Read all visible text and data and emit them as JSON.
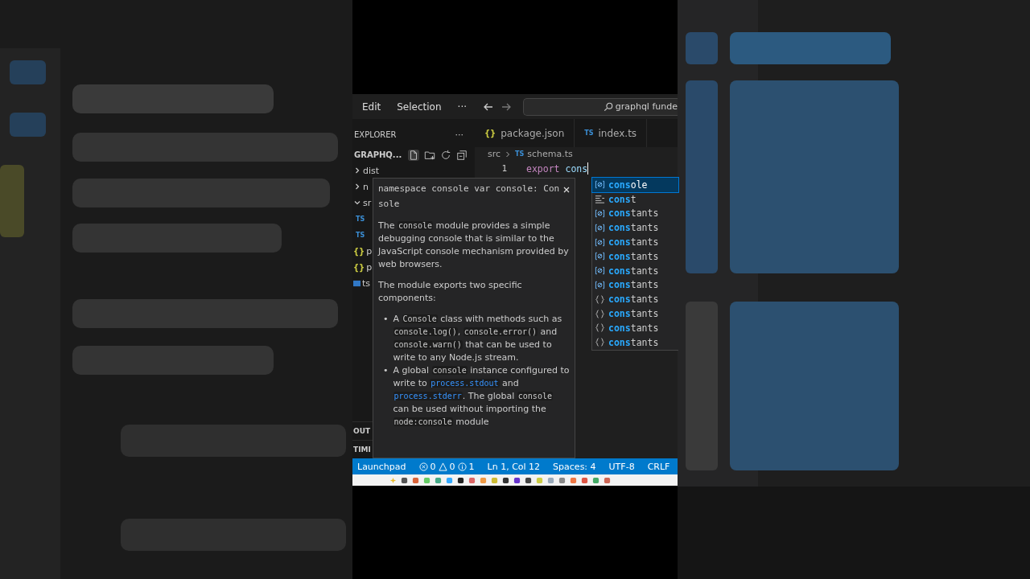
{
  "menu": [
    {
      "label": "Edit"
    },
    {
      "label": "Selection"
    },
    {
      "label": "···"
    }
  ],
  "search": {
    "value": "graphql funde"
  },
  "sidebar": {
    "title": "EXPLORER",
    "more": "···",
    "folder": "GRAPHQ...",
    "tree": [
      {
        "kind": "folder",
        "label": "dist",
        "expanded": false
      },
      {
        "kind": "folder",
        "label": "n",
        "expanded": false
      },
      {
        "kind": "folder",
        "label": "sr",
        "expanded": true,
        "children": [
          {
            "kind": "ts",
            "icon": "TS"
          },
          {
            "kind": "ts",
            "icon": "TS"
          }
        ]
      },
      {
        "kind": "json",
        "icon": "{}",
        "label": "p"
      },
      {
        "kind": "json",
        "icon": "{}",
        "label": "p"
      },
      {
        "kind": "tsconfig",
        "label": "ts"
      }
    ],
    "panels": [
      {
        "label": "OUT"
      },
      {
        "label": "TIMI"
      }
    ]
  },
  "tabs": [
    {
      "kind": "json",
      "icon": "{}",
      "label": "package.json",
      "selected": false
    },
    {
      "kind": "ts",
      "icon": "TS",
      "label": "index.ts",
      "selected": false
    }
  ],
  "breadcrumb": {
    "folder": "src",
    "icon": "TS",
    "file": "schema.ts"
  },
  "editor": {
    "lines": [
      {
        "number": "1",
        "keyword": "export",
        "text": "cons"
      }
    ]
  },
  "hover": {
    "signature": "namespace console var console: Con sole",
    "paragraphs": [
      [
        {
          "kind": "text",
          "text": "The "
        },
        {
          "kind": "code",
          "text": "console"
        },
        {
          "kind": "text",
          "text": " module provides a simple debugging console that is similar to the JavaScript console mechanism provided by web browsers."
        }
      ],
      [
        {
          "kind": "text",
          "text": "The module exports two specific components:"
        }
      ]
    ],
    "bullets": [
      {
        "marker": "•",
        "parts": [
          {
            "kind": "text",
            "text": "A "
          },
          {
            "kind": "code",
            "text": "Console"
          },
          {
            "kind": "text",
            "text": " class with methods such as "
          },
          {
            "kind": "code",
            "text": "console.log()"
          },
          {
            "kind": "text",
            "text": ", "
          },
          {
            "kind": "code",
            "text": "console.error()"
          },
          {
            "kind": "text",
            "text": " and "
          },
          {
            "kind": "code",
            "text": "console.warn()"
          },
          {
            "kind": "text",
            "text": " that can be used to write to any Node.js stream."
          }
        ]
      },
      {
        "marker": "•",
        "parts": [
          {
            "kind": "text",
            "text": "A global "
          },
          {
            "kind": "code",
            "text": "console"
          },
          {
            "kind": "text",
            "text": " instance configured to write to "
          },
          {
            "kind": "link",
            "text": "process.stdout"
          },
          {
            "kind": "text",
            "text": " and "
          },
          {
            "kind": "link",
            "text": "process.stderr"
          },
          {
            "kind": "text",
            "text": ". The global "
          },
          {
            "kind": "code",
            "text": "console"
          },
          {
            "kind": "text",
            "text": " can be used without importing the "
          },
          {
            "kind": "code",
            "text": "node:console"
          },
          {
            "kind": "text",
            "text": " module"
          }
        ]
      }
    ]
  },
  "suggestions": [
    {
      "kind": "variable",
      "match": "cons",
      "rest": "ole",
      "selected": true
    },
    {
      "kind": "keyword",
      "match": "cons",
      "rest": "t",
      "selected": false
    },
    {
      "kind": "variable",
      "match": "cons",
      "rest": "tants",
      "selected": false
    },
    {
      "kind": "variable",
      "match": "cons",
      "rest": "tants",
      "selected": false
    },
    {
      "kind": "variable",
      "match": "cons",
      "rest": "tants",
      "selected": false
    },
    {
      "kind": "variable",
      "match": "cons",
      "rest": "tants",
      "selected": false
    },
    {
      "kind": "variable",
      "match": "cons",
      "rest": "tants",
      "selected": false
    },
    {
      "kind": "variable",
      "match": "cons",
      "rest": "tants",
      "selected": false
    },
    {
      "kind": "module",
      "match": "cons",
      "rest": "tants",
      "selected": false
    },
    {
      "kind": "module",
      "match": "cons",
      "rest": "tants",
      "selected": false
    },
    {
      "kind": "module",
      "match": "cons",
      "rest": "tants",
      "selected": false
    },
    {
      "kind": "module",
      "match": "cons",
      "rest": "tants",
      "selected": false
    }
  ],
  "status_bar": {
    "launchpad": "Launchpad",
    "errors": "0",
    "warnings": "0",
    "infos": "1",
    "position": "Ln 1, Col 12",
    "spaces": "Spaces: 4",
    "encoding": "UTF-8",
    "eol": "CRLF"
  }
}
